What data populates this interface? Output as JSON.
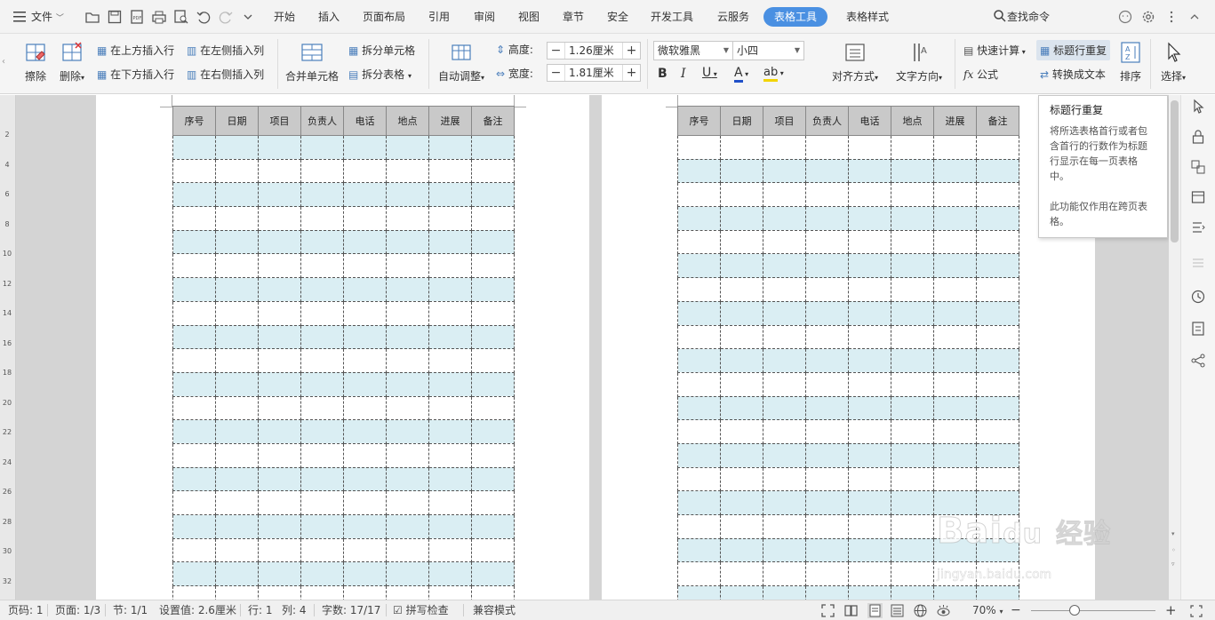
{
  "menubar": {
    "file_label": "文件",
    "tabs": [
      "开始",
      "插入",
      "页面布局",
      "引用",
      "审阅",
      "视图",
      "章节",
      "安全",
      "开发工具",
      "云服务",
      "表格工具",
      "表格样式"
    ],
    "active_tab": "表格工具",
    "search_label": "查找命令",
    "active_color": "#4a90e2"
  },
  "ribbon": {
    "erase": "擦除",
    "delete": "删除",
    "insert_row_above": "在上方插入行",
    "insert_row_below": "在下方插入行",
    "insert_col_left": "在左侧插入列",
    "insert_col_right": "在右侧插入列",
    "merge_cells": "合并单元格",
    "split_cells": "拆分单元格",
    "split_table": "拆分表格",
    "auto_adjust": "自动调整",
    "height_label": "高度:",
    "height_value": "1.26厘米",
    "width_label": "宽度:",
    "width_value": "1.81厘米",
    "font_name": "微软雅黑",
    "font_size": "小四",
    "bold": "B",
    "italic": "I",
    "underline": "U",
    "font_color": "A",
    "highlight": "ab",
    "align": "对齐方式",
    "text_direction": "文字方向",
    "quick_calc": "快速计算",
    "formula": "公式",
    "repeat_header": "标题行重复",
    "convert_text": "转换成文本",
    "sort": "排序",
    "select": "选择"
  },
  "table": {
    "headers": [
      "序号",
      "日期",
      "项目",
      "负责人",
      "电话",
      "地点",
      "进展",
      "备注"
    ],
    "header_color": "#c9c9c9",
    "stripe_color": "#daeef3"
  },
  "tooltip": {
    "title": "标题行重复",
    "body": "将所选表格首行或者包含首行的行数作为标题行显示在每一页表格中。",
    "note": "此功能仅作用在跨页表格。"
  },
  "ruler": [
    "2",
    "4",
    "6",
    "8",
    "10",
    "12",
    "14",
    "16",
    "18",
    "20",
    "22",
    "24",
    "26",
    "28",
    "30",
    "32"
  ],
  "statusbar": {
    "page_num": "页码: 1",
    "page_of": "页面: 1/3",
    "section": "节: 1/1",
    "setting": "设置值: 2.6厘米",
    "row": "行: 1",
    "col": "列: 4",
    "words": "字数: 17/17",
    "spell": "拼写检查",
    "compat": "兼容模式",
    "zoom": "70%"
  },
  "watermark": {
    "brand": "Bai",
    "brand2": "du",
    "jingyan": "经验",
    "url": "jingyan.baidu.com"
  }
}
